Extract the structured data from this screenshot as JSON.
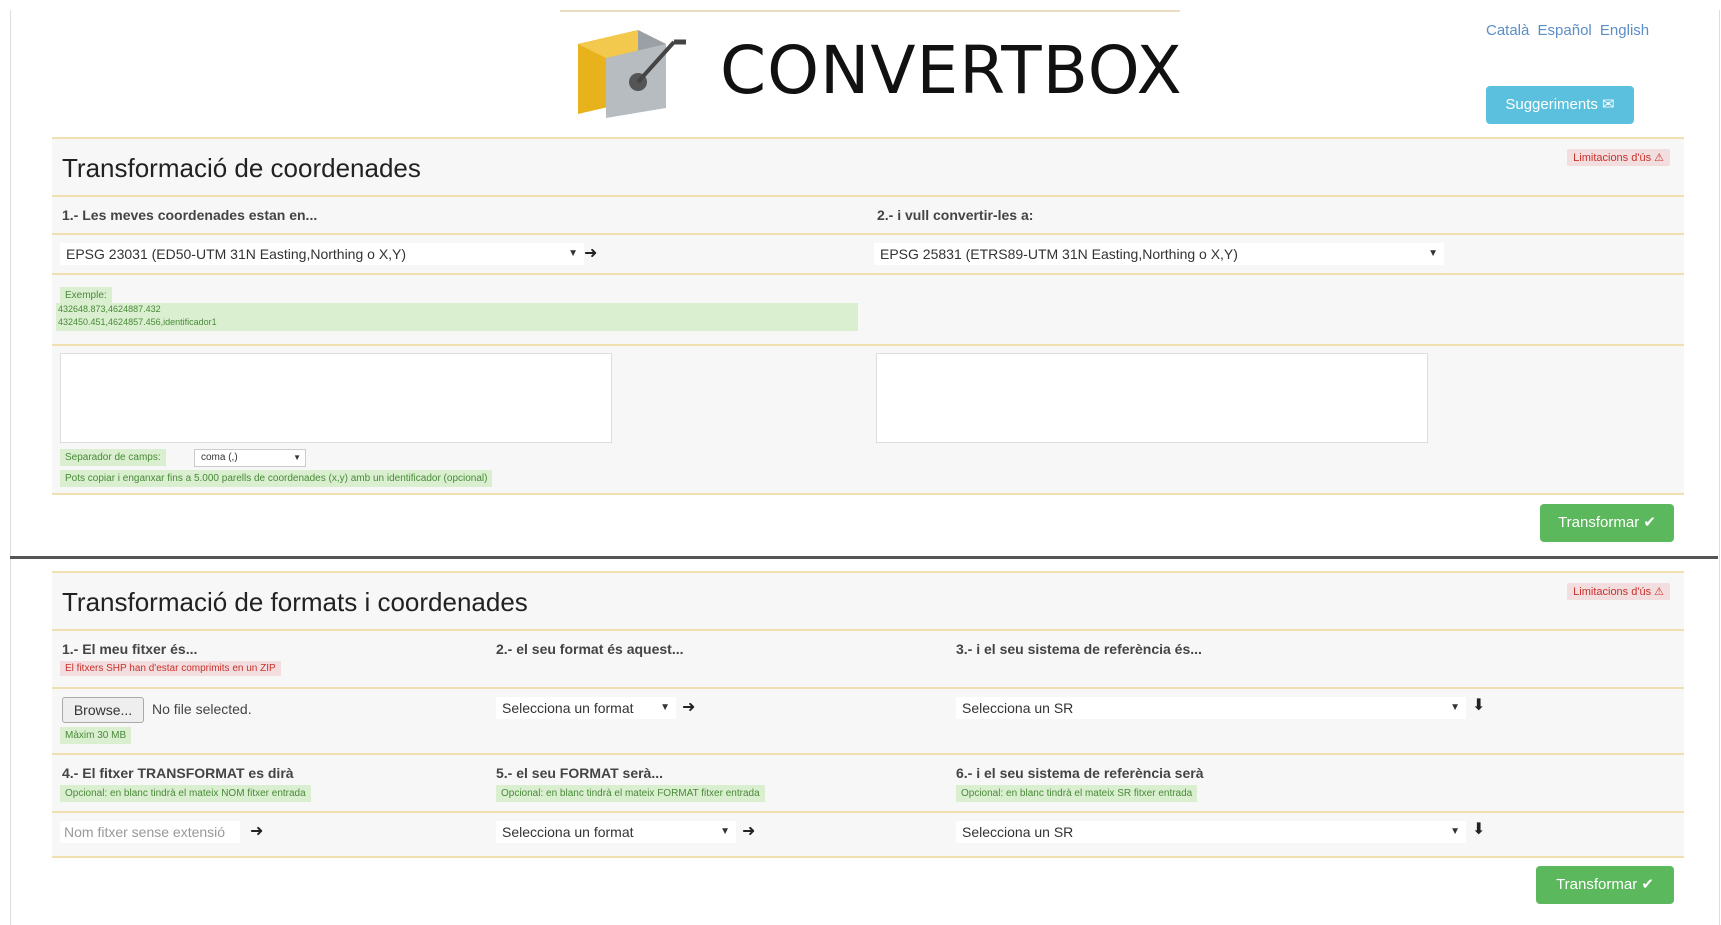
{
  "header": {
    "app_name": "CONVERTBOX",
    "languages": [
      "Català",
      "Español",
      "English"
    ],
    "suggestions_label": "Suggeriments ✉"
  },
  "section1": {
    "title": "Transformació de coordenades",
    "limit_badge": "Limitacions d'ús ⚠",
    "step1_label": "1.- Les meves coordenades estan en...",
    "step2_label": "2.- i vull convertir-les a:",
    "source_crs": "EPSG 23031 (ED50-UTM 31N Easting,Northing o X,Y)",
    "target_crs": "EPSG 25831 (ETRS89-UTM 31N Easting,Northing o X,Y)",
    "example_title": "Exemple:",
    "example_line1": "432648.873,4624887.432",
    "example_line2": "432450.451,4624857.456,identificador1",
    "separator_label": "Separador de camps:",
    "separator_value": "coma (,)",
    "help_note": "Pots copiar i enganxar fins a 5.000 parells de coordenades (x,y) amb un identificador (opcional)",
    "transform_label": "Transformar ✔"
  },
  "section2": {
    "title": "Transformació de formats i coordenades",
    "limit_badge": "Limitacions d'ús ⚠",
    "step1_label": "1.- El meu fitxer és...",
    "step1_note": "El fitxers SHP han d'estar comprimits en un ZIP",
    "browse_label": "Browse...",
    "no_file": "No file selected.",
    "max_size": "Màxim 30 MB",
    "step2_label": "2.- el seu format és aquest...",
    "format_select": "Selecciona un format",
    "step3_label": "3.- i el seu sistema de referència és...",
    "sr_select": "Selecciona un SR",
    "step4_label": "4.- El fitxer TRANSFORMAT es dirà",
    "step4_note": "Opcional: en blanc tindrà el mateix NOM fitxer entrada",
    "filename_placeholder": "Nom fitxer sense extensió",
    "step5_label": "5.- el seu FORMAT serà...",
    "step5_note": "Opcional: en blanc tindrà el mateix FORMAT fitxer entrada",
    "out_format_select": "Selecciona un format",
    "step6_label": "6.- i el seu sistema de referència serà",
    "step6_note": "Opcional: en blanc tindrà el mateix SR fitxer entrada",
    "out_sr_select": "Selecciona un SR",
    "transform_label": "Transformar ✔"
  },
  "colors": {
    "accent_blue": "#5bc0de",
    "accent_green": "#5cb85c",
    "panel_border": "#f0e0b0"
  }
}
